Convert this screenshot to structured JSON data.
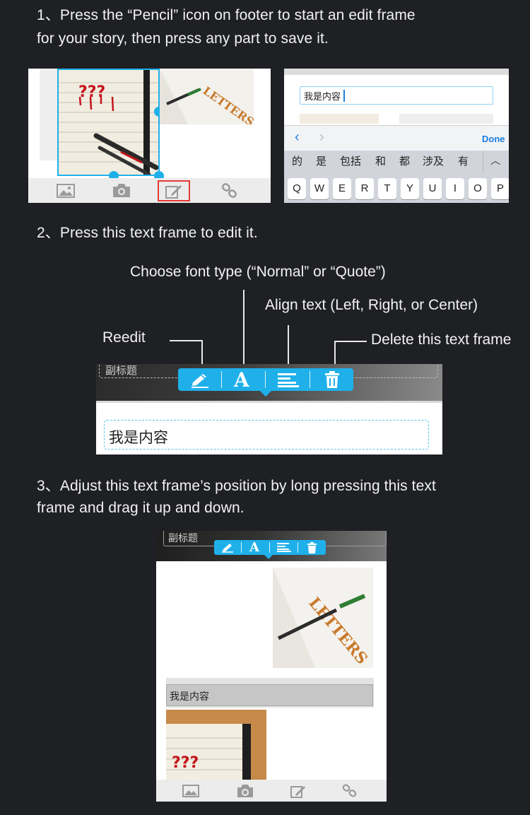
{
  "step1": {
    "line1": "1、Press the “Pencil” icon on footer to start an edit frame",
    "line2": "for your story, then press any part to save it."
  },
  "step2": {
    "text": "2、Press this text frame to edit it."
  },
  "step3": {
    "line1": "3、Adjust this text frame’s position by long pressing this text",
    "line2": "frame and drag it up and down."
  },
  "annotations": {
    "font_type": "Choose font type (“Normal” or “Quote”)",
    "align": "Align text (Left, Right, or Center)",
    "reedit": "Reedit",
    "delete": "Delete this text frame"
  },
  "screen1": {
    "footer_icons": [
      "image-icon",
      "camera-icon",
      "pencil-icon",
      "link-icon"
    ],
    "highlight_color": "#e53935",
    "letters_art": "LETTERS"
  },
  "screen2": {
    "input_value": "我是内容",
    "nav_done": "Done",
    "candidates": [
      "的",
      "是",
      "包括",
      "和",
      "都",
      "涉及",
      "有"
    ],
    "keys": [
      "Q",
      "W",
      "E",
      "R",
      "T",
      "Y",
      "U",
      "I",
      "O",
      "P"
    ]
  },
  "editor_demo": {
    "subtitle_partial": "副标题",
    "content_text": "我是内容"
  },
  "screen3": {
    "subtitle": "副标题",
    "content_text": "我是内容"
  },
  "colors": {
    "background": "#1f2024",
    "accent": "#1fb0ea",
    "ios_blue": "#1a7fe0"
  }
}
